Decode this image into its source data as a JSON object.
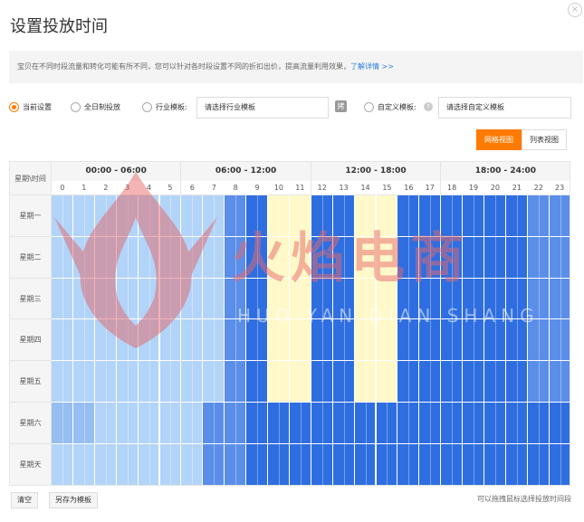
{
  "dialog": {
    "title": "设置投放时间",
    "close_icon": "×"
  },
  "notice": {
    "text": "宝贝在不同时段流量和转化可能有所不同，您可以针对各时段设置不同的折扣出价，提高流量利用效果，",
    "link": "了解详情 >>"
  },
  "options": {
    "current_setting": "当前设置",
    "all_day": "全日制投放",
    "industry_template": "行业模板:",
    "industry_placeholder": "请选择行业模板",
    "custom_template": "自定义模板:",
    "custom_placeholder": "请选择自定义模板",
    "selected": "current_setting",
    "template_icon": "拷"
  },
  "view": {
    "grid_label": "网格视图",
    "list_label": "列表视图",
    "active": "grid"
  },
  "schedule": {
    "corner_label": "星期\\时间",
    "ranges": [
      "00:00 - 06:00",
      "06:00 - 12:00",
      "12:00 - 18:00",
      "18:00 - 24:00"
    ],
    "hours": [
      "0",
      "1",
      "2",
      "3",
      "4",
      "5",
      "6",
      "7",
      "8",
      "9",
      "10",
      "11",
      "12",
      "13",
      "14",
      "15",
      "16",
      "17",
      "18",
      "19",
      "20",
      "21",
      "22",
      "23"
    ],
    "days": [
      "星期一",
      "星期二",
      "星期三",
      "星期四",
      "星期五",
      "星期六",
      "星期天"
    ],
    "level_colors": [
      "#b3d4f9",
      "#96bef1",
      "#5a8ee9",
      "#2f6ee0",
      "#fff8c8"
    ],
    "levels": [
      [
        0,
        0,
        0,
        0,
        0,
        0,
        0,
        0,
        2,
        3,
        4,
        4,
        3,
        3,
        4,
        4,
        3,
        3,
        3,
        3,
        3,
        3,
        2,
        2
      ],
      [
        0,
        0,
        0,
        0,
        0,
        0,
        0,
        0,
        2,
        3,
        4,
        4,
        3,
        3,
        4,
        4,
        3,
        3,
        3,
        3,
        3,
        3,
        2,
        2
      ],
      [
        0,
        0,
        0,
        0,
        0,
        0,
        0,
        0,
        2,
        3,
        4,
        4,
        3,
        3,
        4,
        4,
        3,
        3,
        3,
        3,
        3,
        3,
        2,
        2
      ],
      [
        0,
        0,
        0,
        0,
        0,
        0,
        0,
        0,
        2,
        3,
        4,
        4,
        3,
        3,
        4,
        4,
        3,
        3,
        3,
        3,
        3,
        3,
        2,
        2
      ],
      [
        0,
        0,
        0,
        0,
        0,
        0,
        0,
        0,
        2,
        3,
        4,
        4,
        3,
        3,
        4,
        4,
        3,
        3,
        3,
        3,
        3,
        3,
        2,
        2
      ],
      [
        1,
        1,
        0,
        0,
        0,
        0,
        0,
        2,
        2,
        3,
        3,
        3,
        3,
        3,
        3,
        3,
        3,
        3,
        3,
        3,
        3,
        3,
        3,
        3
      ],
      [
        0,
        0,
        0,
        0,
        0,
        0,
        0,
        2,
        2,
        3,
        3,
        3,
        3,
        3,
        3,
        3,
        3,
        3,
        3,
        3,
        3,
        3,
        3,
        3
      ]
    ]
  },
  "watermark": {
    "title": "火焰电商",
    "subtitle": "HUO YAN DIAN SHANG"
  },
  "footer": {
    "clear": "清空",
    "save_template": "另存为模板",
    "hint": "可以拖拽鼠标选择投放时间段"
  }
}
